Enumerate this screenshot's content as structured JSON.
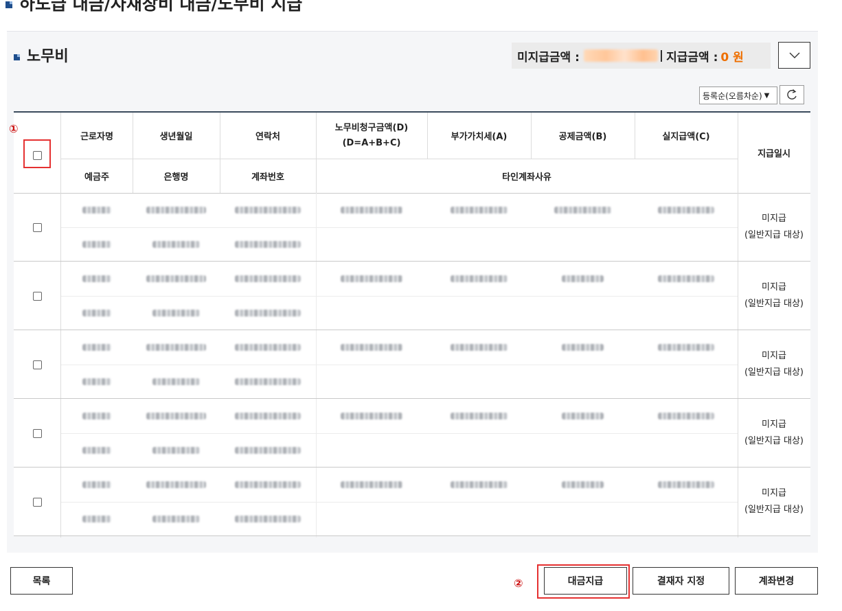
{
  "page": {
    "title": "하도급 대금/자재장비 대금/노무비 지급"
  },
  "section": {
    "title": "노무비",
    "unpaid_label": "미지급금액 :",
    "separator": "|",
    "paid_label": "지급금액 :",
    "paid_value": "0 원"
  },
  "controls": {
    "sort_value": "등록순(오름차순)",
    "toggle_icon": "chevron-down-icon",
    "refresh_icon": "refresh-icon"
  },
  "table": {
    "headers_row1": [
      "근로자명",
      "생년월일",
      "연락처",
      "노무비청구금액(D)",
      "부가가치세(A)",
      "공제금액(B)",
      "실지급액(C)"
    ],
    "header_formula": "(D=A+B+C)",
    "header_paydate": "지급일시",
    "headers_row2": [
      "예금주",
      "은행명",
      "계좌번호",
      "타인계좌사유"
    ],
    "rows": [
      {
        "status_line1": "미지급",
        "status_line2": "(일반지급 대상)"
      },
      {
        "status_line1": "미지급",
        "status_line2": "(일반지급 대상)"
      },
      {
        "status_line1": "미지급",
        "status_line2": "(일반지급 대상)"
      },
      {
        "status_line1": "미지급",
        "status_line2": "(일반지급 대상)"
      },
      {
        "status_line1": "미지급",
        "status_line2": "(일반지급 대상)"
      }
    ]
  },
  "annotations": {
    "marker1": "①",
    "marker2": "②"
  },
  "footer": {
    "list_button": "목록",
    "pay_button": "대금지급",
    "approver_button": "결재자 지정",
    "account_change_button": "계좌변경"
  }
}
